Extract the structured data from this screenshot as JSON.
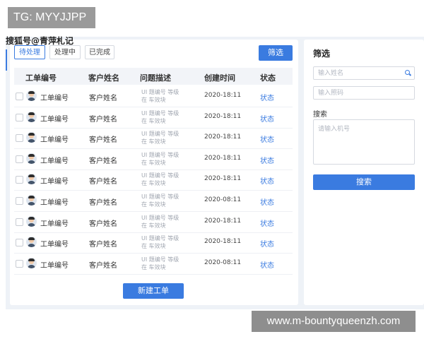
{
  "overlays": {
    "tg_label": "TG: MYYJJPP",
    "author_watermark": "搜狐号@青萍札记",
    "site_watermark": "www.m-bountyqueenzh.com"
  },
  "tabs": [
    {
      "label": "待处理",
      "active": true
    },
    {
      "label": "处理中",
      "active": false
    },
    {
      "label": "已完成",
      "active": false
    }
  ],
  "toolbar": {
    "filter_label": "筛选"
  },
  "table": {
    "columns": [
      "工单编号",
      "客户姓名",
      "问题描述",
      "创建时间",
      "状态"
    ],
    "rows": [
      {
        "id": "工单编号",
        "name": "客户姓名",
        "desc_line1": "UI 题编号  等级",
        "desc_line2": "在 车效块",
        "time": "2020-18:11",
        "status": "状态"
      },
      {
        "id": "工单编号",
        "name": "客户姓名",
        "desc_line1": "UI 题编号  等级",
        "desc_line2": "在 车效块",
        "time": "2020-18:11",
        "status": "状态"
      },
      {
        "id": "工单编号",
        "name": "客户姓名",
        "desc_line1": "UI 题编号  等级",
        "desc_line2": "在 车效块",
        "time": "2020-18:11",
        "status": "状态"
      },
      {
        "id": "工单编号",
        "name": "客户姓名",
        "desc_line1": "UI 题编号  等级",
        "desc_line2": "在 车效块",
        "time": "2020-18:11",
        "status": "状态"
      },
      {
        "id": "工单编号",
        "name": "客户姓名",
        "desc_line1": "UI 题编号  等级",
        "desc_line2": "在 车效块",
        "time": "2020-18:11",
        "status": "状态"
      },
      {
        "id": "工单编号",
        "name": "客户姓名",
        "desc_line1": "UI 题编号  等级",
        "desc_line2": "在 车效块",
        "time": "2020-08:11",
        "status": "状态"
      },
      {
        "id": "工单编号",
        "name": "客户姓名",
        "desc_line1": "UI 题编号  等级",
        "desc_line2": "在 车效块",
        "time": "2020-18:11",
        "status": "状态"
      },
      {
        "id": "工单编号",
        "name": "客户姓名",
        "desc_line1": "UI 题编号  等级",
        "desc_line2": "在 车效块",
        "time": "2020-18:11",
        "status": "状态"
      },
      {
        "id": "工单编号",
        "name": "客户姓名",
        "desc_line1": "UI 题编号  等级",
        "desc_line2": "在 车效块",
        "time": "2020-08:11",
        "status": "状态"
      }
    ]
  },
  "footer": {
    "create_label": "新建工单"
  },
  "side": {
    "title": "筛选",
    "name_placeholder": "输入姓名",
    "phone_placeholder": "输入照码",
    "search_label": "搜索",
    "machine_placeholder": "请输入机号",
    "search_button": "搜索"
  },
  "colors": {
    "accent": "#3a7be0",
    "page_bg": "#eef2f7"
  }
}
